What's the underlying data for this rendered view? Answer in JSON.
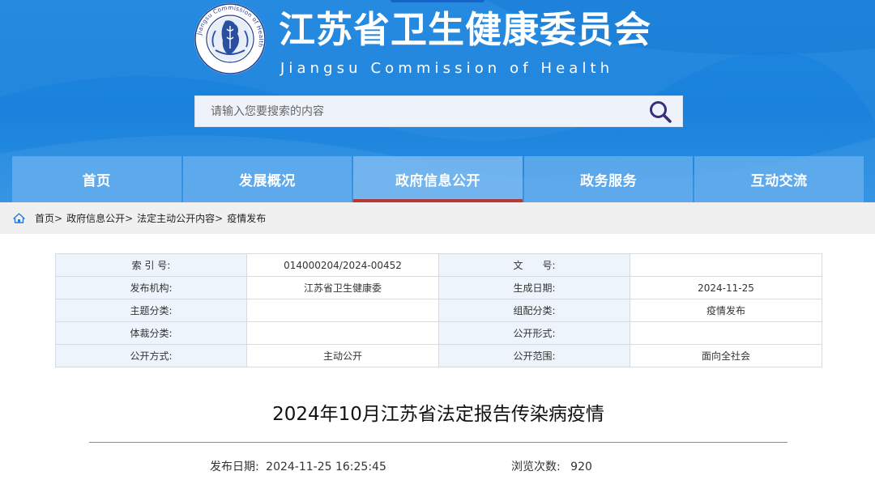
{
  "header": {
    "title_cn": "江苏省卫生健康委员会",
    "title_en": "Jiangsu Commission of Health",
    "logo_ring_text": "Jiangsu Commission of Health"
  },
  "search": {
    "placeholder": "请输入您要搜索的内容"
  },
  "nav": {
    "items": [
      "首页",
      "发展概况",
      "政府信息公开",
      "政务服务",
      "互动交流"
    ],
    "active": "政府信息公开"
  },
  "breadcrumb": {
    "items": [
      "首页",
      "政府信息公开",
      "法定主动公开内容",
      "疫情发布"
    ],
    "separator": ">"
  },
  "meta": {
    "rows": [
      {
        "l1": "索 引 号:",
        "v1": "014000204/2024-00452",
        "l2": "文　　号:",
        "v2": ""
      },
      {
        "l1": "发布机构:",
        "v1": "江苏省卫生健康委",
        "l2": "生成日期:",
        "v2": "2024-11-25"
      },
      {
        "l1": "主题分类:",
        "v1": "",
        "l2": "组配分类:",
        "v2": "疫情发布"
      },
      {
        "l1": "体裁分类:",
        "v1": "",
        "l2": "公开形式:",
        "v2": ""
      },
      {
        "l1": "公开方式:",
        "v1": "主动公开",
        "l2": "公开范围:",
        "v2": "面向全社会"
      }
    ]
  },
  "article": {
    "title": "2024年10月江苏省法定报告传染病疫情",
    "publish_label": "发布日期:",
    "publish_date": "2024-11-25 16:25:45",
    "views_label": "浏览次数:",
    "views": "920"
  },
  "colors": {
    "header_blue": "#1a82dc",
    "nav_active_underline": "#b23a3a",
    "search_icon": "#3a2e7a",
    "table_label_bg": "#eef4fb"
  },
  "icons": {
    "search": "search-icon",
    "home": "home-icon",
    "logo": "logo-emblem-icon"
  }
}
